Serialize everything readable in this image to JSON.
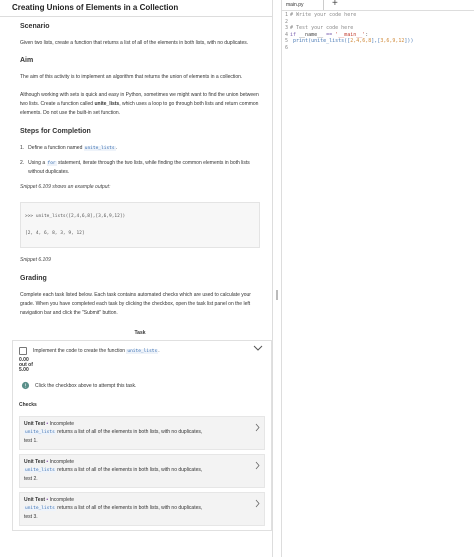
{
  "title": "Creating Unions of Elements in a Collection",
  "scenario": {
    "heading": "Scenario",
    "text": "Given two lists, create a function that returns a list of all of the elements in both lists, with no duplicates."
  },
  "aim": {
    "heading": "Aim",
    "text": "The aim of this activity is to implement an algorithm that returns the union of elements in a collection.",
    "text2_pre": "Although working with sets is quick and easy in Python, sometimes we might want to find the union between two lists. Create a function called ",
    "text2_bold": "unite_lists",
    "text2_post": ", which uses a loop to go through both lists and return common elements. Do not use the built-in set function."
  },
  "steps": {
    "heading": "Steps for Completion",
    "items": [
      {
        "num": "1.",
        "pre": "Define a function named ",
        "code": "unite_lists",
        "post": "."
      },
      {
        "num": "2.",
        "pre": "Using a ",
        "code": "for",
        "post": " statement, iterate through the two lists, while finding the common elements in both lists without duplicates."
      }
    ],
    "snippet_caption": "Snippet 6.109 shows an example output:",
    "code_lines": [
      ">>> unite_lists([2,4,6,8],[3,6,9,12])",
      "[2, 4, 6, 8, 3, 9, 12]"
    ],
    "snippet_label": "Snippet 6.109"
  },
  "grading": {
    "heading": "Grading",
    "text": "Complete each task listed below. Each task contains automated checks which are used to calculate your grade. When you have completed each task by clicking the checkbox, open the task list panel on the left navigation bar and click the \"Submit\" button."
  },
  "task": {
    "label": "Task",
    "text_pre": "Implement the code to create the function ",
    "code": "unite_lists",
    "text_post": ".",
    "score_line1": "0.00",
    "score_line2": "out of",
    "score_line3": "5.00",
    "hint": "Click the checkbox above to attempt this task.",
    "checks_heading": "Checks",
    "checks": [
      {
        "title": "Unit Test",
        "status": "Incomplete",
        "code": "unite_lists",
        "desc": " returns a list of all of the elements in both lists, with no duplicates,",
        "test": "test 1."
      },
      {
        "title": "Unit Test",
        "status": "Incomplete",
        "code": "unite_lists",
        "desc": " returns a list of all of the elements in both lists, with no duplicates,",
        "test": "test 2."
      },
      {
        "title": "Unit Test",
        "status": "Incomplete",
        "code": "unite_lists",
        "desc": " returns a list of all of the elements in both lists, with no duplicates,",
        "test": "test 3."
      }
    ]
  },
  "editor": {
    "tab": "main.py",
    "add_icon": "plus-icon",
    "line_numbers": [
      "1",
      "2",
      "3",
      "4",
      "5",
      "6"
    ],
    "line1_comment": "# Write your code here",
    "line3_comment": "# Test your code here",
    "line4_kw": "if",
    "line4_name": " __name__ ",
    "line4_op": "==",
    "line4_str": " '__main__'",
    "line4_end": ":",
    "line5_fn": "print",
    "line5_mid": "(unite_lists([",
    "line5_nums1": "2,4,6,8",
    "line5_sep": "],[",
    "line5_nums2": "3,6,9,12",
    "line5_end": "]))"
  },
  "colors": {
    "code_accent": "#3a6fb0",
    "incomplete_dot": "#7a3fa0"
  }
}
